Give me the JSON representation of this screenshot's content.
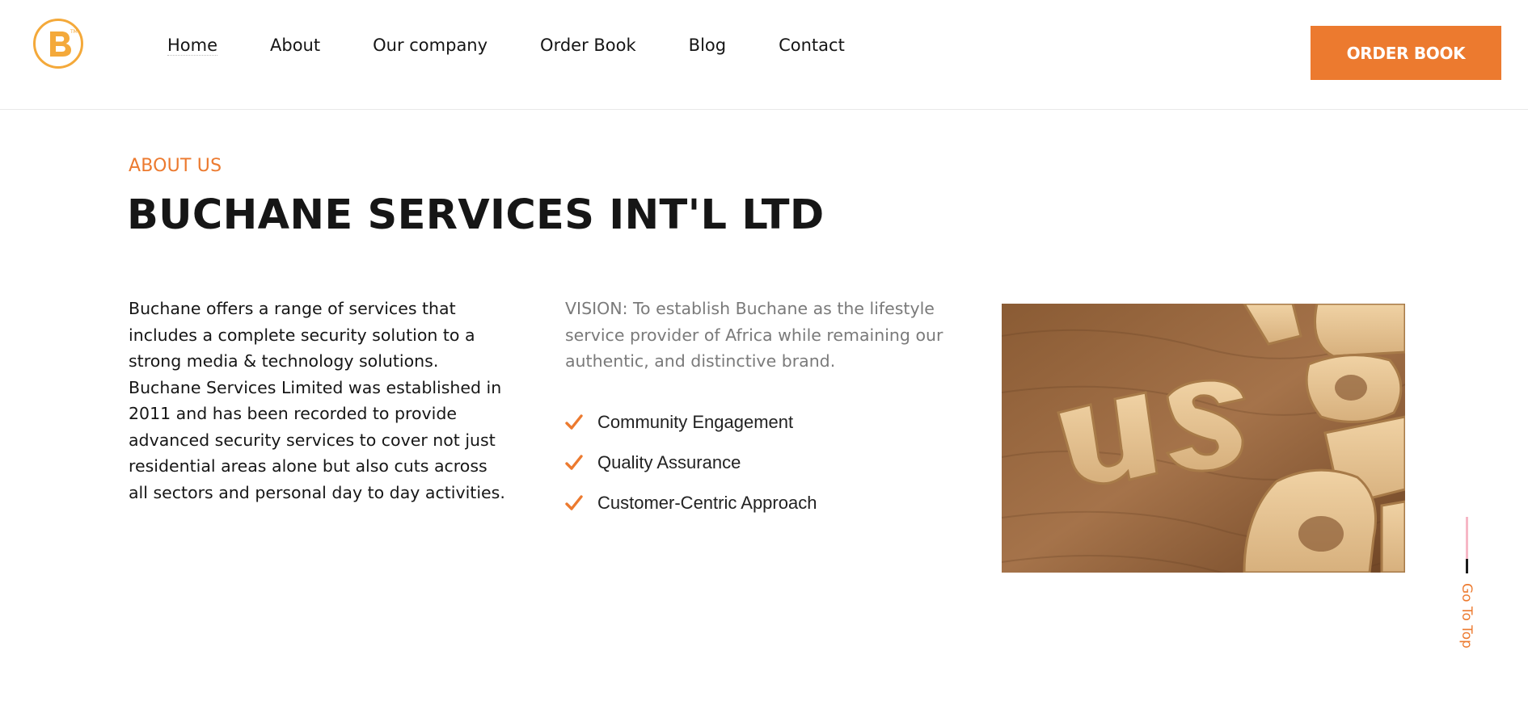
{
  "header": {
    "logo_letter": "B",
    "nav": [
      {
        "label": "Home"
      },
      {
        "label": "About"
      },
      {
        "label": "Our company"
      },
      {
        "label": "Order Book"
      },
      {
        "label": "Blog"
      },
      {
        "label": "Contact"
      }
    ],
    "cta_label": "ORDER BOOK"
  },
  "about": {
    "eyebrow": "ABOUT US",
    "title": "BUCHANE SERVICES INT'L LTD",
    "intro": "Buchane offers a range of services that includes a complete security solution to a strong media & technology solutions. Buchane Services Limited was established in 2011 and has been recorded to provide advanced security services to cover not just residential areas alone but also cuts across all sectors and personal day to day activities.",
    "vision": "VISION: To establish Buchane as the lifestyle service provider of Africa while remaining our authentic, and distinctive brand.",
    "features": [
      {
        "label": "Community Engagement",
        "icon": "check-icon"
      },
      {
        "label": "Quality Assurance",
        "icon": "check-icon"
      },
      {
        "label": "Customer-Centric Approach",
        "icon": "check-icon"
      }
    ],
    "image_subject": "wooden letters spelling about us"
  },
  "go_top": {
    "label": "Go To Top"
  },
  "colors": {
    "accent": "#ec7a2f",
    "logo": "#f4a93a",
    "text": "#161616",
    "muted": "#7a7a7a"
  }
}
